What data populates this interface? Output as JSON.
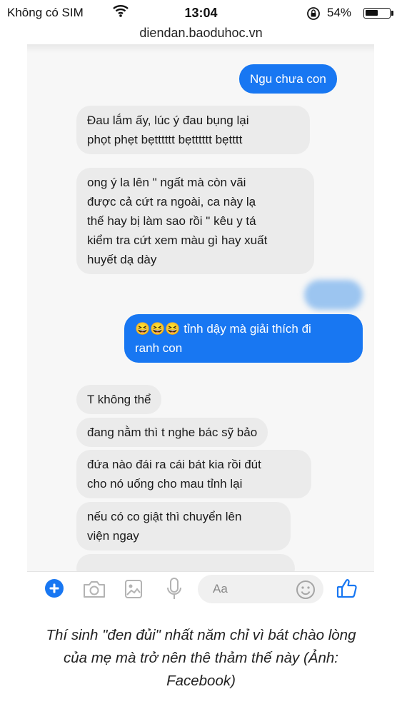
{
  "status_bar": {
    "carrier": "Không có SIM",
    "time": "13:04",
    "battery_percent": "54%",
    "battery_level": 0.54
  },
  "address_bar": {
    "url": "diendan.baoduhoc.vn"
  },
  "messages": [
    {
      "from": "me",
      "text": "Ngu chưa con"
    },
    {
      "from": "them",
      "lines": [
        "Đau lắm ấy, lúc ý đau bụng lại",
        "phọt phẹt bẹtttttt bẹtttttt bẹtttt"
      ]
    },
    {
      "from": "them",
      "lines": [
        "ong ý la lên \" ngất mà còn vãi",
        "được cả cứt ra ngoài, ca này lạ",
        "thế hay bị làm sao rồi \" kêu y tá",
        "kiểm tra cứt xem màu gì hay xuất",
        "huyết dạ dày"
      ]
    },
    {
      "from": "me",
      "lines": [
        "😆😆😆 tỉnh dậy mà giải thích đi",
        "ranh con"
      ]
    },
    {
      "from": "them",
      "text": "T không thể"
    },
    {
      "from": "them",
      "text": "đang nằm thì t nghe bác sỹ bảo"
    },
    {
      "from": "them",
      "lines": [
        "đứa nào đái ra cái bát kia rồi đút",
        "cho nó uống cho mau tỉnh lại"
      ]
    },
    {
      "from": "them",
      "lines": [
        "nếu có co giật thì chuyển lên",
        "viện ngay"
      ]
    }
  ],
  "composer": {
    "placeholder": "Aa"
  },
  "icons": [
    "wifi-icon",
    "orientation-lock-icon",
    "battery-icon",
    "plus-icon",
    "camera-icon",
    "gallery-icon",
    "microphone-icon",
    "smiley-icon",
    "thumbs-up-icon"
  ],
  "colors": {
    "outgoing_bubble": "#1877f2",
    "incoming_bubble": "#ebebeb"
  },
  "caption": {
    "lines": [
      "Thí sinh \"đen đủi\" nhất năm chỉ vì bát chào lòng",
      "của mẹ mà trở nên thê thảm thế này (Ảnh:",
      "Facebook)"
    ]
  }
}
